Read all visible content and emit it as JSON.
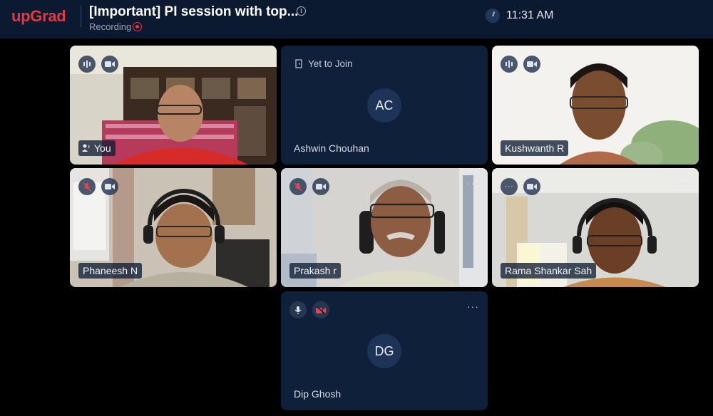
{
  "header": {
    "logo": "upGrad",
    "title": "[Important] PI session with top...",
    "recording_label": "Recording",
    "time": "11:31 AM"
  },
  "tiles": [
    {
      "name": "You"
    },
    {
      "name": "Ashwin Chouhan",
      "status": "Yet to Join",
      "initials": "AC"
    },
    {
      "name": "Kushwanth R"
    },
    {
      "name": "Phaneesh N"
    },
    {
      "name": "Prakash r"
    },
    {
      "name": "Rama Shankar Sah"
    },
    {
      "name": "Dip Ghosh",
      "initials": "DG"
    }
  ],
  "more_label": "···",
  "colors": {
    "brand": "#e8373f",
    "topbar": "#0b1a30",
    "tile_bg": "#0f203b",
    "muted_mic": "#e2474f"
  }
}
